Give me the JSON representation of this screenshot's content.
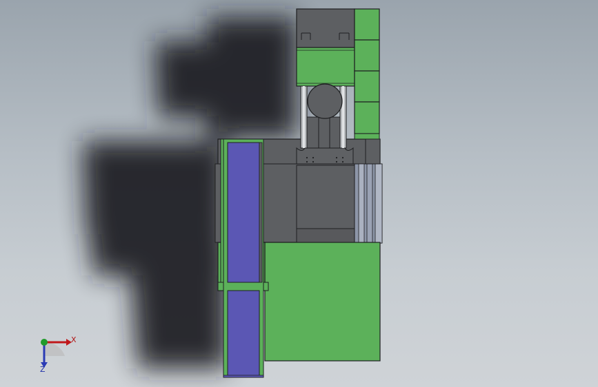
{
  "viewport": {
    "background_top": "#9aa4ad",
    "background_bottom": "#cfd3d7"
  },
  "colors": {
    "shadow": "#1b1d20",
    "body_dark": "#5d5f62",
    "body_edge": "#1e1f21",
    "green_part": "#5cb15a",
    "blue_part": "#5b57b4",
    "rod": "#b9bcbf",
    "light_bar": "#9aa2b4"
  },
  "triad": {
    "x_label": "X",
    "z_label": "Z",
    "x_color": "#c0181b",
    "y_color": "#1f9a2a",
    "z_color": "#2a3bb5"
  }
}
